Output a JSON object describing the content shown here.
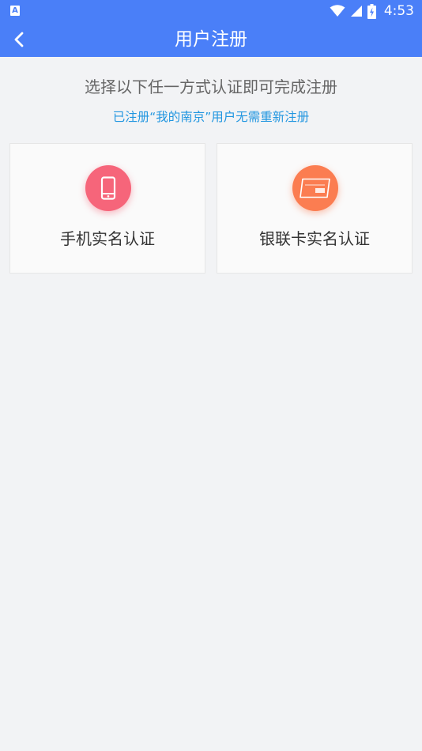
{
  "status_bar": {
    "app_icon_letter": "A",
    "time": "4:53",
    "icons": [
      "wifi-icon",
      "cell-signal-icon",
      "battery-icon"
    ]
  },
  "header": {
    "title": "用户注册",
    "back_icon": "chevron-left-icon"
  },
  "main": {
    "subtitle": "选择以下任一方式认证即可完成注册",
    "notice": "已注册“我的南京”用户无需重新注册",
    "options": [
      {
        "label": "手机实名认证",
        "icon": "phone-icon",
        "color": "#f6657a"
      },
      {
        "label": "银联卡实名认证",
        "icon": "unionpay-card-icon",
        "color": "#fb7d51"
      }
    ]
  },
  "colors": {
    "accent": "#4a7ff8",
    "notice": "#2196e0",
    "background": "#f2f3f5"
  }
}
